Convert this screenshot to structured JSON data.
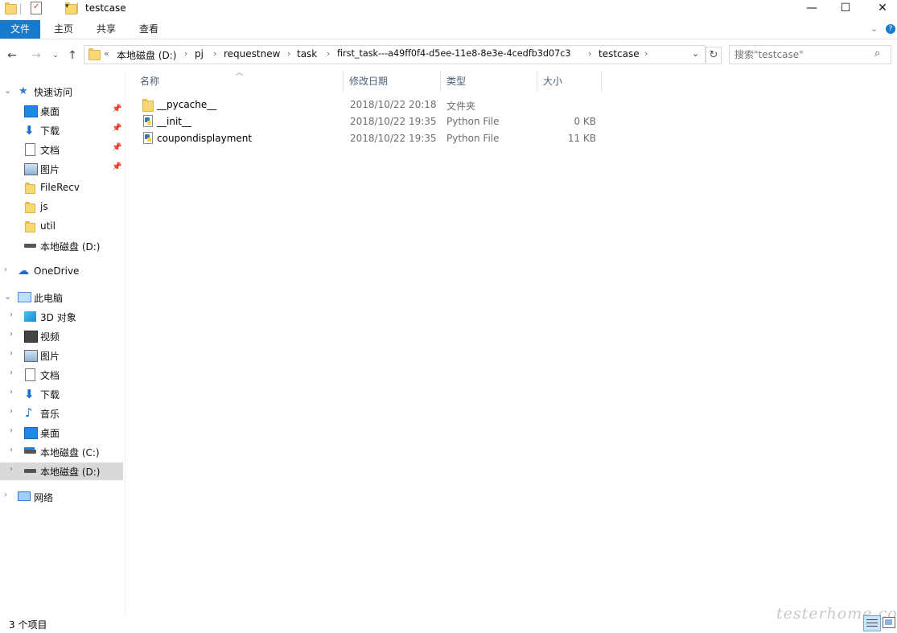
{
  "window": {
    "title": "testcase",
    "controls": {
      "minimize": "—",
      "maximize": "☐",
      "close": "✕"
    }
  },
  "ribbon": {
    "tabs": [
      "文件",
      "主页",
      "共享",
      "查看"
    ],
    "expand_icon": "chevron-down-icon",
    "help_icon": "help-icon"
  },
  "address": {
    "overflow": "«",
    "crumbs": [
      "本地磁盘 (D:)",
      "pj",
      "requestnew",
      "task",
      "first_task---a49ff0f4-d5ee-11e8-8e3e-4cedfb3d07c3",
      "testcase"
    ],
    "search_placeholder": "搜索\"testcase\""
  },
  "sidebar": {
    "quick_access": {
      "label": "快速访问",
      "items": [
        {
          "label": "桌面",
          "icon": "desktop-icon",
          "pinned": true
        },
        {
          "label": "下载",
          "icon": "download-icon",
          "pinned": true
        },
        {
          "label": "文档",
          "icon": "document-icon",
          "pinned": true
        },
        {
          "label": "图片",
          "icon": "picture-icon",
          "pinned": true
        },
        {
          "label": "FileRecv",
          "icon": "folder-icon",
          "pinned": false
        },
        {
          "label": "js",
          "icon": "folder-icon",
          "pinned": false
        },
        {
          "label": "util",
          "icon": "folder-icon",
          "pinned": false
        },
        {
          "label": "本地磁盘 (D:)",
          "icon": "drive-icon",
          "pinned": false
        }
      ]
    },
    "onedrive": {
      "label": "OneDrive",
      "icon": "cloud-icon"
    },
    "this_pc": {
      "label": "此电脑",
      "items": [
        {
          "label": "3D 对象",
          "icon": "cube-icon"
        },
        {
          "label": "视频",
          "icon": "video-icon"
        },
        {
          "label": "图片",
          "icon": "picture-icon"
        },
        {
          "label": "文档",
          "icon": "document-icon"
        },
        {
          "label": "下载",
          "icon": "download-icon"
        },
        {
          "label": "音乐",
          "icon": "music-icon"
        },
        {
          "label": "桌面",
          "icon": "desktop-icon"
        },
        {
          "label": "本地磁盘 (C:)",
          "icon": "drive-icon"
        },
        {
          "label": "本地磁盘 (D:)",
          "icon": "drive-icon",
          "selected": true
        }
      ]
    },
    "network": {
      "label": "网络",
      "icon": "network-icon"
    }
  },
  "file_list": {
    "columns": [
      "名称",
      "修改日期",
      "类型",
      "大小"
    ],
    "rows": [
      {
        "name": "__pycache__",
        "date": "2018/10/22 20:18",
        "type": "文件夹",
        "size": "",
        "icon": "folder-icon"
      },
      {
        "name": "__init__",
        "date": "2018/10/22 19:35",
        "type": "Python File",
        "size": "0 KB",
        "icon": "python-file-icon"
      },
      {
        "name": "coupondisplayment",
        "date": "2018/10/22 19:35",
        "type": "Python File",
        "size": "11 KB",
        "icon": "python-file-icon"
      }
    ]
  },
  "status": {
    "item_count": "3 个项目"
  },
  "watermark": "testerhome.com",
  "colors": {
    "accent": "#1979ca",
    "selected_bg": "#d9d9d9"
  }
}
